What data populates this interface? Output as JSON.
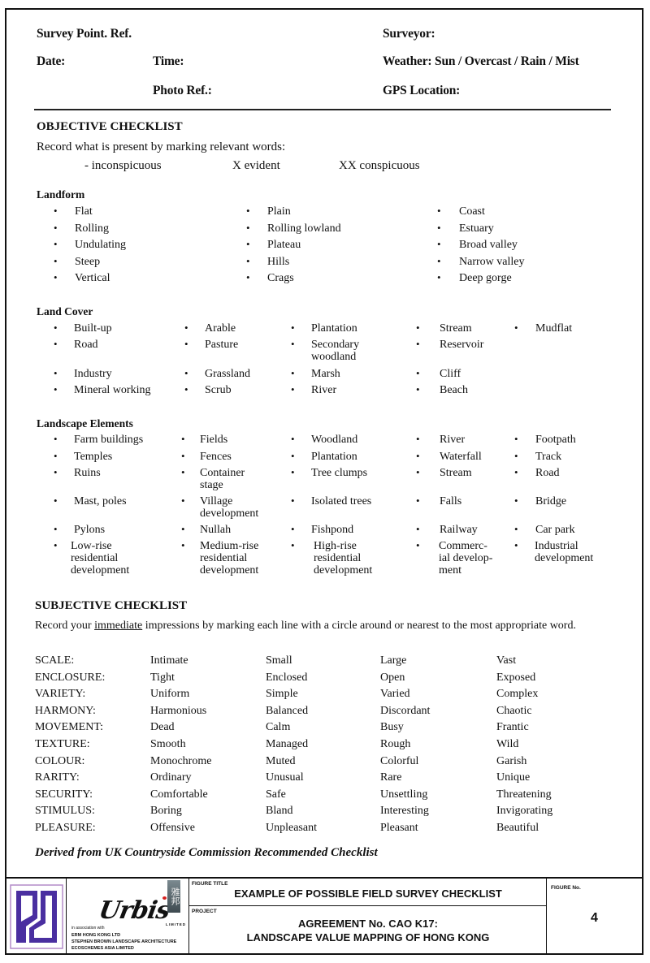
{
  "header": {
    "survey_point_ref": "Survey Point. Ref.",
    "surveyor": "Surveyor:",
    "date": "Date:",
    "time": "Time:",
    "weather": "Weather: Sun / Overcast / Rain / Mist",
    "photo_ref": "Photo Ref.:",
    "gps_location": "GPS Location:"
  },
  "objective": {
    "title": "OBJECTIVE CHECKLIST",
    "instruction": "Record what is present by marking relevant words:",
    "key": [
      "- inconspicuous",
      "X evident",
      "XX conspicuous"
    ],
    "landform": {
      "title": "Landform",
      "columns": [
        [
          "Flat",
          "Rolling",
          "Undulating",
          "Steep",
          "Vertical"
        ],
        [
          "Plain",
          "Rolling lowland",
          "Plateau",
          "Hills",
          "Crags"
        ],
        [
          "Coast",
          "Estuary",
          "Broad valley",
          "Narrow valley",
          "Deep gorge"
        ]
      ]
    },
    "land_cover": {
      "title": "Land Cover",
      "rows": [
        [
          "Built-up",
          "Arable",
          "Plantation",
          "Stream",
          "Mudflat"
        ],
        [
          "Road",
          "Pasture",
          "Secondary\nwoodland",
          "Reservoir",
          ""
        ],
        [
          "Industry",
          "Grassland",
          "Marsh",
          "Cliff",
          ""
        ],
        [
          "Mineral working",
          "Scrub",
          "River",
          "Beach",
          ""
        ]
      ]
    },
    "landscape_elements": {
      "title": "Landscape Elements",
      "rows": [
        [
          "Farm buildings",
          "Fields",
          "Woodland",
          "River",
          "Footpath"
        ],
        [
          "Temples",
          "Fences",
          "Plantation",
          "Waterfall",
          "Track"
        ],
        [
          "Ruins",
          "Container\nstage",
          "Tree clumps",
          "Stream",
          "Road"
        ],
        [
          "Mast, poles",
          "Village\ndevelopment",
          "Isolated trees",
          "Falls",
          "Bridge"
        ],
        [
          "Pylons",
          "Nullah",
          "Fishpond",
          "Railway",
          "Car park"
        ],
        [
          "Low-rise\nresidential\ndevelopment",
          "Medium-rise\nresidential\ndevelopment",
          "High-rise\nresidential\ndevelopment",
          "Commerc-\nial develop-\nment",
          "Industrial\ndevelopment"
        ]
      ]
    }
  },
  "subjective": {
    "title": "SUBJECTIVE CHECKLIST",
    "instruction_pre": "Record your ",
    "instruction_underlined": "immediate",
    "instruction_post": " impressions by marking each line with a circle around or nearest to the most appropriate word.",
    "rows": [
      {
        "label": "SCALE:",
        "options": [
          "Intimate",
          "Small",
          "Large",
          "Vast"
        ]
      },
      {
        "label": "ENCLOSURE:",
        "options": [
          "Tight",
          "Enclosed",
          "Open",
          "Exposed"
        ]
      },
      {
        "label": "VARIETY:",
        "options": [
          "Uniform",
          "Simple",
          "Varied",
          "Complex"
        ]
      },
      {
        "label": "HARMONY:",
        "options": [
          "Harmonious",
          "Balanced",
          "Discordant",
          "Chaotic"
        ]
      },
      {
        "label": "MOVEMENT:",
        "options": [
          "Dead",
          "Calm",
          "Busy",
          "Frantic"
        ]
      },
      {
        "label": "TEXTURE:",
        "options": [
          "Smooth",
          "Managed",
          "Rough",
          "Wild"
        ]
      },
      {
        "label": "COLOUR:",
        "options": [
          "Monochrome",
          "Muted",
          "Colorful",
          "Garish"
        ]
      },
      {
        "label": "RARITY:",
        "options": [
          "Ordinary",
          "Unusual",
          "Rare",
          "Unique"
        ]
      },
      {
        "label": "SECURITY:",
        "options": [
          "Comfortable",
          "Safe",
          "Unsettling",
          "Threatening"
        ]
      },
      {
        "label": "STIMULUS:",
        "options": [
          "Boring",
          "Bland",
          "Interesting",
          "Invigorating"
        ]
      },
      {
        "label": "PLEASURE:",
        "options": [
          "Offensive",
          "Unpleasant",
          "Pleasant",
          "Beautiful"
        ]
      }
    ],
    "source_note": "Derived from UK Countryside Commission Recommended Checklist"
  },
  "title_block": {
    "logo_mark": "PD logo",
    "company_script": "Urbis",
    "company_chinese": "雅邦",
    "company_limited": "LIMITED",
    "association_label": "in association with",
    "partners": [
      "ERM HONG KONG LTD",
      "STEPHEN BROWN LANDSCAPE ARCHITECTURE",
      "ECOSCHEMES ASIA LIMITED"
    ],
    "figure_title_label": "FIGURE TITLE",
    "figure_title": "EXAMPLE OF POSSIBLE FIELD SURVEY CHECKLIST",
    "project_label": "PROJECT",
    "project_line1": "AGREEMENT No. CAO K17:",
    "project_line2": "LANDSCAPE VALUE MAPPING OF HONG KONG",
    "figure_no_label": "FIGURE No.",
    "figure_no": "4",
    "colors": {
      "logo_purple": "#4a2fa0",
      "logo_border": "#b48cc8",
      "accent_red": "#d6201f"
    }
  }
}
